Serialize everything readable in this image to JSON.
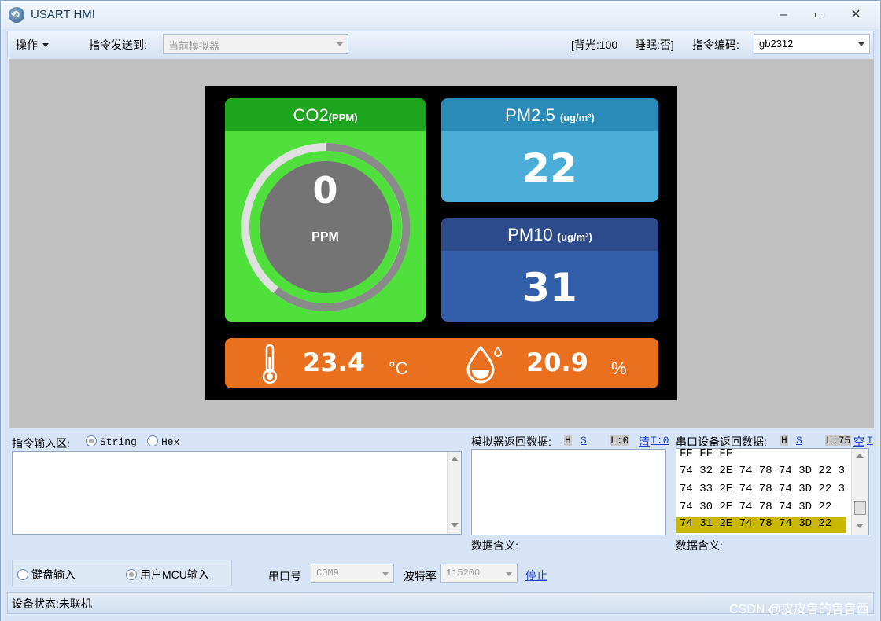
{
  "window": {
    "title": "USART HMI",
    "minimize": "–",
    "maximize": "▭",
    "close": "✕"
  },
  "menubar": {
    "operate_label": "操作",
    "send_to_label": "指令发送到:",
    "send_to_value": "当前模拟器",
    "backlight_text": "[背光:100",
    "sleep_text": "睡眠:否]",
    "encoding_label": "指令编码:",
    "encoding_value": "gb2312"
  },
  "screen": {
    "co2": {
      "title": "CO2",
      "unit_small": "(PPM)",
      "value": "0",
      "unit": "PPM",
      "level": 0
    },
    "pm25": {
      "title": "PM2.5",
      "unit_small": "(ug/m³)",
      "value": "22"
    },
    "pm10": {
      "title": "PM10",
      "unit_small": "(ug/m³)",
      "value": "31"
    },
    "temperature": {
      "value": "23.4",
      "unit": "°C"
    },
    "humidity": {
      "value": "20.9",
      "unit": "%"
    },
    "colors": {
      "co2_bg": "#50e03c",
      "pm25_bg": "#4aaed8",
      "pm10_bg": "#325faa",
      "env_bg": "#e8701e"
    }
  },
  "command_input": {
    "label": "指令输入区:",
    "string_option": "String",
    "hex_option": "Hex"
  },
  "simulator_return": {
    "label": "模拟器返回数据:",
    "h": "H",
    "s": "S",
    "length": "L:0",
    "clear": "清",
    "t": "T:0",
    "meaning_label": "数据含义:"
  },
  "serial_return": {
    "label": "串口设备返回数据:",
    "h": "H",
    "s": "S",
    "length": "L:75",
    "empty": "空",
    "t": "T",
    "lines": [
      "FF FF FF",
      "74 32 2E 74 78 74 3D 22 3",
      "74 33 2E 74 78 74 3D 22 3",
      "74 30 2E 74 78 74 3D 22",
      "74 31 2E 74 78 74 3D 22"
    ],
    "meaning_label": "数据含义:"
  },
  "input_mode": {
    "keyboard": "键盘输入",
    "mcu": "用户MCU输入"
  },
  "serial": {
    "port_label": "串口号",
    "port_value": "COM9",
    "baud_label": "波特率",
    "baud_value": "115200",
    "stop_label": "停止"
  },
  "status": {
    "text": "设备状态:未联机"
  },
  "watermark": "CSDN @皮皮鲁的鲁鲁西"
}
